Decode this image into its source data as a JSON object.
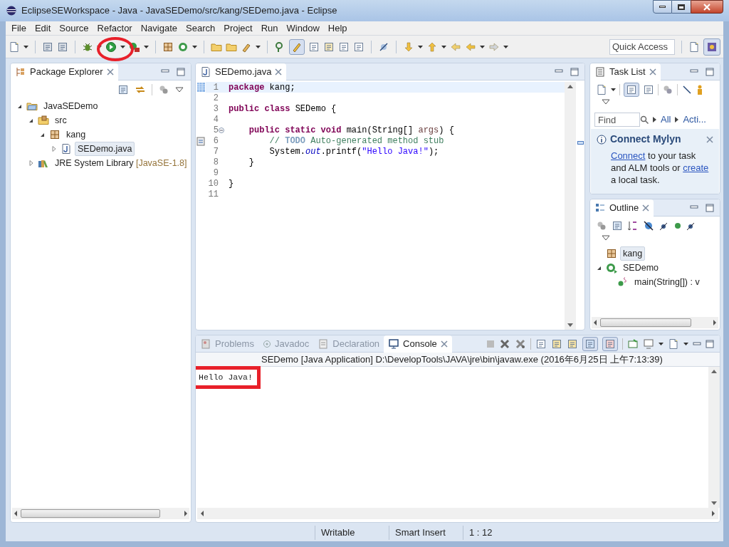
{
  "window": {
    "title": "EclipseSEWorkspace - Java - JavaSEDemo/src/kang/SEDemo.java - Eclipse"
  },
  "menu": [
    "File",
    "Edit",
    "Source",
    "Refactor",
    "Navigate",
    "Search",
    "Project",
    "Run",
    "Window",
    "Help"
  ],
  "quick_access": {
    "placeholder": "Quick Access"
  },
  "package_explorer": {
    "title": "Package Explorer",
    "tree": [
      {
        "kind": "project",
        "label": "JavaSEDemo",
        "expanded": true,
        "selected": false,
        "children": [
          {
            "kind": "source-folder",
            "label": "src",
            "expanded": true,
            "selected": false,
            "children": [
              {
                "kind": "package",
                "label": "kang",
                "expanded": true,
                "selected": false,
                "children": [
                  {
                    "kind": "java-file",
                    "label": "SEDemo.java",
                    "expanded": false,
                    "selected": true
                  }
                ]
              }
            ]
          },
          {
            "kind": "library",
            "label": "JRE System Library",
            "decoration": "[JavaSE-1.8]",
            "expanded": false,
            "selected": false
          }
        ]
      }
    ]
  },
  "editor": {
    "tab": "SEDemo.java",
    "lines": [
      {
        "number": "1",
        "kind": "occurrence",
        "current": true,
        "segments": [
          {
            "kind": "keyword",
            "text": "package "
          },
          {
            "kind": "plain",
            "text": "kang;"
          }
        ]
      },
      {
        "number": "2",
        "kind": "plain",
        "current": false
      },
      {
        "number": "3",
        "kind": "plain",
        "current": false,
        "segments": [
          {
            "kind": "keyword",
            "text": "public class "
          },
          {
            "kind": "plain",
            "text": "SEDemo {"
          }
        ]
      },
      {
        "number": "4",
        "kind": "plain",
        "current": false
      },
      {
        "number": "5",
        "kind": "fold",
        "current": false,
        "segments": [
          {
            "kind": "keyword",
            "text": "    public static void "
          },
          {
            "kind": "plain",
            "text": "main(String[] "
          },
          {
            "kind": "param",
            "text": "args"
          },
          {
            "kind": "plain",
            "text": ") {"
          }
        ]
      },
      {
        "number": "6",
        "kind": "task",
        "current": false,
        "segments": [
          {
            "kind": "comment",
            "text": "        // "
          },
          {
            "kind": "todo",
            "text": "TODO"
          },
          {
            "kind": "comment",
            "text": " Auto-generated method stub"
          }
        ]
      },
      {
        "number": "7",
        "kind": "plain",
        "current": false,
        "segments": [
          {
            "kind": "plain",
            "text": "        System."
          },
          {
            "kind": "field",
            "text": "out"
          },
          {
            "kind": "plain",
            "text": ".printf("
          },
          {
            "kind": "string",
            "text": "\"Hello Java!\""
          },
          {
            "kind": "plain",
            "text": ");"
          }
        ]
      },
      {
        "number": "8",
        "kind": "plain",
        "current": false,
        "segments": [
          {
            "kind": "plain",
            "text": "    }"
          }
        ]
      },
      {
        "number": "9",
        "kind": "plain",
        "current": false
      },
      {
        "number": "10",
        "kind": "plain",
        "current": false,
        "segments": [
          {
            "kind": "plain",
            "text": "}"
          }
        ]
      },
      {
        "number": "11",
        "kind": "plain",
        "current": false
      }
    ]
  },
  "task_list": {
    "title": "Task List",
    "find": {
      "placeholder": "Find"
    },
    "filters": [
      "All",
      "Acti..."
    ],
    "mylyn": {
      "title": "Connect Mylyn",
      "parts": [
        {
          "kind": "link",
          "text": "Connect"
        },
        {
          "kind": "text",
          "text": " to your task and ALM tools or "
        },
        {
          "kind": "link",
          "text": "create"
        },
        {
          "kind": "text",
          "text": " a local task."
        }
      ]
    }
  },
  "outline": {
    "title": "Outline",
    "tree": [
      {
        "kind": "package",
        "label": "kang",
        "selected": true
      },
      {
        "kind": "class",
        "label": "SEDemo",
        "expanded": true,
        "selected": false,
        "children": [
          {
            "kind": "method",
            "label": "main(String[]) : v",
            "selected": false
          }
        ]
      }
    ]
  },
  "console": {
    "tabs": [
      {
        "kind": "problems",
        "label": "Problems",
        "selected": false
      },
      {
        "kind": "javadoc",
        "label": "Javadoc",
        "selected": false
      },
      {
        "kind": "declaration",
        "label": "Declaration",
        "selected": false
      },
      {
        "kind": "console",
        "label": "Console",
        "selected": true
      }
    ],
    "header": "SEDemo [Java Application] D:\\DevelopTools\\JAVA\\jre\\bin\\javaw.exe (2016年6月25日 上午7:13:39)",
    "output": "Hello Java!"
  },
  "status_bar": [
    "Writable",
    "Smart Insert",
    "1 : 12"
  ]
}
